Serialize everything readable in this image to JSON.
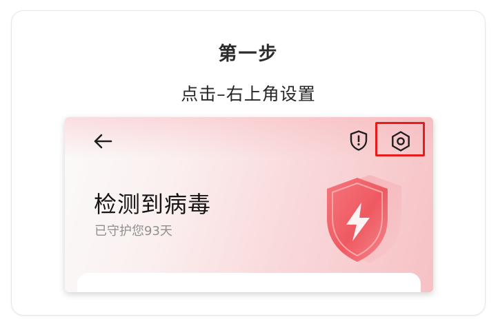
{
  "instruction": {
    "step_title": "第一步",
    "step_description": "点击–右上角设置"
  },
  "screen": {
    "status_title": "检测到病毒",
    "status_subtitle": "已守护您93天",
    "icons": {
      "back": "arrow-left-icon",
      "security": "shield-alert-icon",
      "settings": "hexagon-settings-icon",
      "illustration": "shield-lightning-icon"
    }
  },
  "colors": {
    "highlight": "#e81b1b",
    "gradient_start": "#fbfafa",
    "gradient_end": "#f6c1c4",
    "shield_main": "#f0646c"
  }
}
